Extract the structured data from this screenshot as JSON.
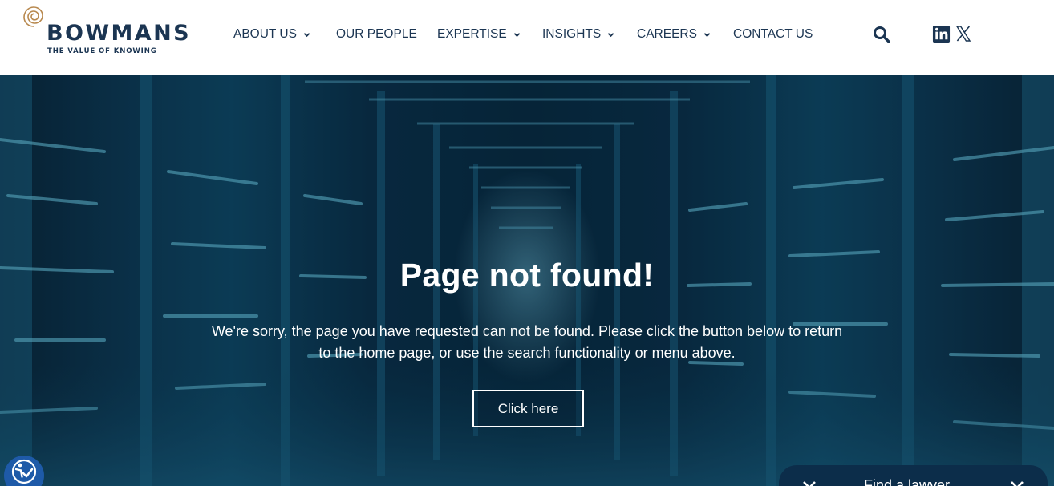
{
  "brand": {
    "name": "BOWMANS",
    "tagline": "THE VALUE OF KNOWING",
    "text_color": "#1b3552",
    "logo_mark_color": "#b8894f"
  },
  "nav": {
    "items": [
      {
        "label": "ABOUT US",
        "has_dropdown": true
      },
      {
        "label": "OUR PEOPLE",
        "has_dropdown": false
      },
      {
        "label": "EXPERTISE",
        "has_dropdown": true
      },
      {
        "label": "INSIGHTS",
        "has_dropdown": true
      },
      {
        "label": "CAREERS",
        "has_dropdown": true
      },
      {
        "label": "CONTACT US",
        "has_dropdown": false
      }
    ],
    "icons": [
      "search-icon",
      "linkedin-icon",
      "x-twitter-icon"
    ]
  },
  "hero": {
    "title": "Page not found!",
    "message": "We're sorry, the page you have requested can not be found. Please click the button below to return to the home page, or use the search functionality or menu above.",
    "button_label": "Click here",
    "overlay_color": "#0a3049"
  },
  "widgets": {
    "accessibility_icon": "accessibility-icon",
    "accessibility_color": "#1e5aa8",
    "find_lawyer_label": "Find a lawyer",
    "find_lawyer_color": "#0c2d4a"
  }
}
